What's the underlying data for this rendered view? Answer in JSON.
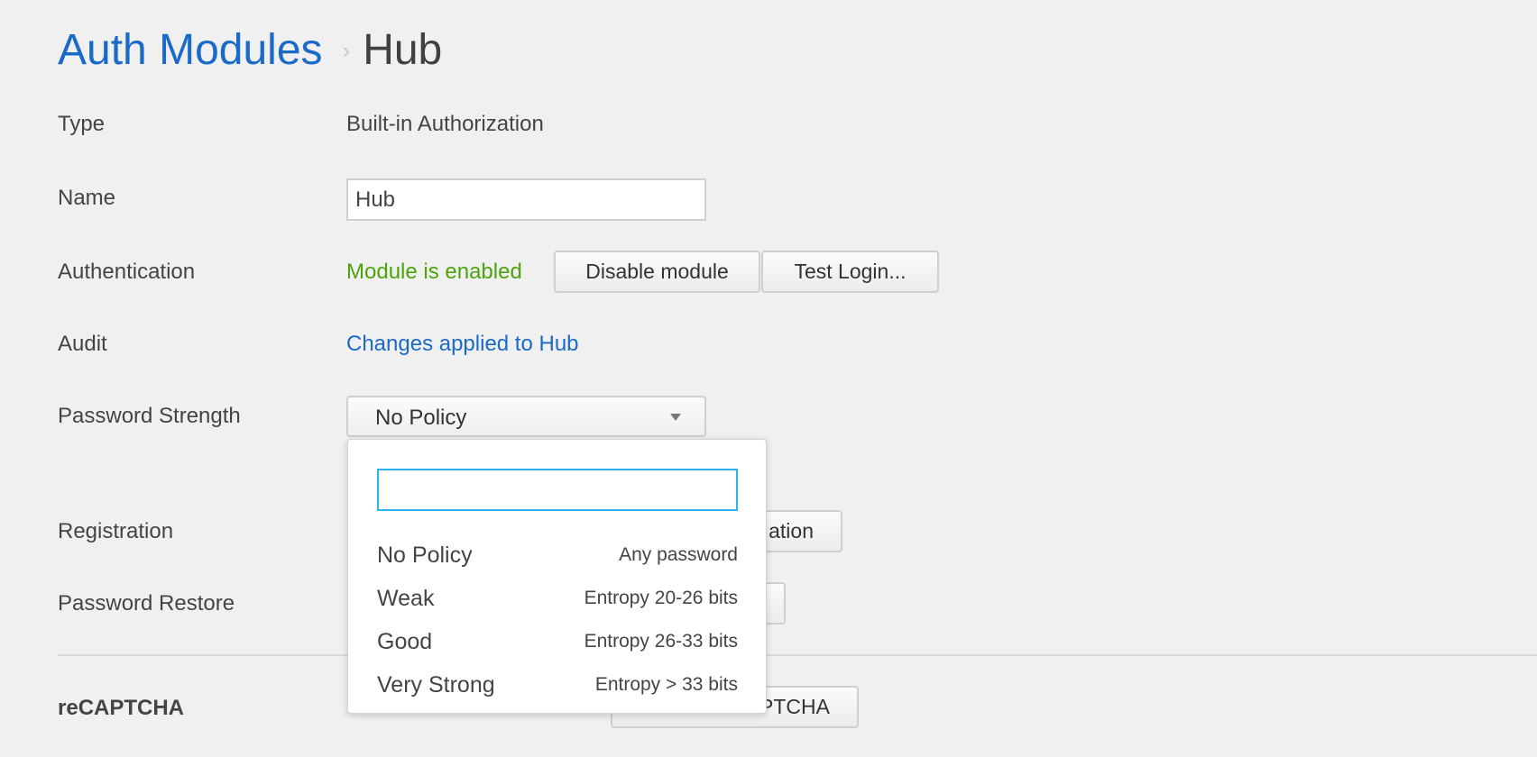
{
  "breadcrumb": {
    "parent": "Auth Modules",
    "separator": "›",
    "current": "Hub"
  },
  "form": {
    "type": {
      "label": "Type",
      "value": "Built-in Authorization"
    },
    "name": {
      "label": "Name",
      "value": "Hub"
    },
    "authentication": {
      "label": "Authentication",
      "status": "Module is enabled",
      "disable_button": "Disable module",
      "test_button": "Test Login..."
    },
    "audit": {
      "label": "Audit",
      "link": "Changes applied to Hub"
    },
    "password_strength": {
      "label": "Password Strength",
      "selected": "No Policy"
    },
    "registration": {
      "label": "Registration",
      "button_visible_text": "ation"
    },
    "password_restore": {
      "label": "Password Restore"
    },
    "recaptcha": {
      "label": "reCAPTCHA",
      "button_visible_text": "PTCHA"
    }
  },
  "dropdown": {
    "search_value": "",
    "options": [
      {
        "name": "No Policy",
        "description": "Any password"
      },
      {
        "name": "Weak",
        "description": "Entropy 20-26 bits"
      },
      {
        "name": "Good",
        "description": "Entropy 26-33 bits"
      },
      {
        "name": "Very Strong",
        "description": "Entropy > 33 bits"
      }
    ]
  },
  "colors": {
    "link": "#1a6ac8",
    "enabled": "#4ca40a",
    "focus": "#2bb5ef",
    "background": "#f0f0f0"
  }
}
